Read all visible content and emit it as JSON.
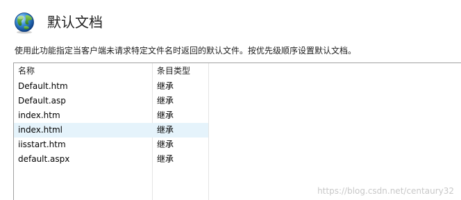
{
  "header": {
    "icon": "globe-icon",
    "title": "默认文档"
  },
  "description": "使用此功能指定当客户端未请求特定文件名时返回的默认文件。按优先级顺序设置默认文档。",
  "table": {
    "columns": {
      "name": "名称",
      "type": "条目类型"
    },
    "rows": [
      {
        "name": "Default.htm",
        "type": "继承",
        "selected": false
      },
      {
        "name": "Default.asp",
        "type": "继承",
        "selected": false
      },
      {
        "name": "index.htm",
        "type": "继承",
        "selected": false
      },
      {
        "name": "index.html",
        "type": "继承",
        "selected": true
      },
      {
        "name": "iisstart.htm",
        "type": "继承",
        "selected": false
      },
      {
        "name": "default.aspx",
        "type": "继承",
        "selected": false
      }
    ],
    "selected_color": "#e5f3fb"
  },
  "watermark": "https://blog.csdn.net/centaury32"
}
